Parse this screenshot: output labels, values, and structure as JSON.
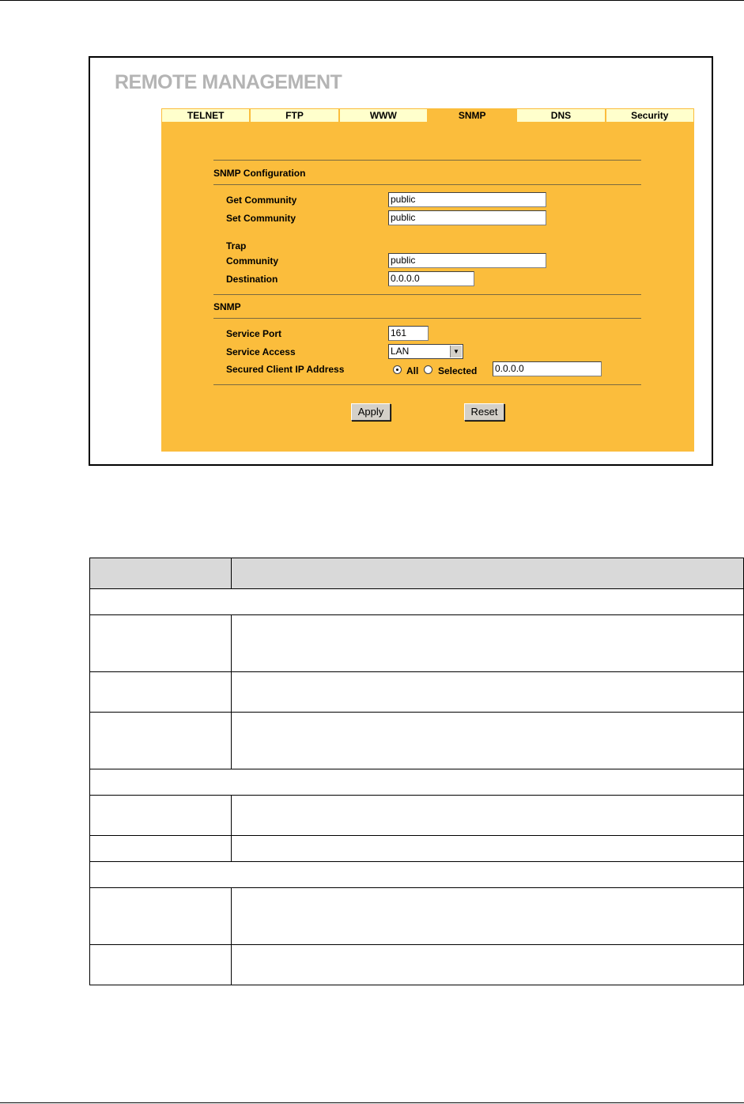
{
  "page_title": "REMOTE MANAGEMENT",
  "tabs": [
    {
      "label": "TELNET",
      "active": false
    },
    {
      "label": "FTP",
      "active": false
    },
    {
      "label": "WWW",
      "active": false
    },
    {
      "label": "SNMP",
      "active": true
    },
    {
      "label": "DNS",
      "active": false
    },
    {
      "label": "Security",
      "active": false
    }
  ],
  "snmp_config": {
    "section_label": "SNMP Configuration",
    "get_community_label": "Get Community",
    "get_community_value": "public",
    "set_community_label": "Set Community",
    "set_community_value": "public",
    "trap_label": "Trap",
    "trap_community_label": "Community",
    "trap_community_value": "public",
    "destination_label": "Destination",
    "destination_value": "0.0.0.0"
  },
  "snmp": {
    "section_label": "SNMP",
    "service_port_label": "Service Port",
    "service_port_value": "161",
    "service_access_label": "Service Access",
    "service_access_value": "LAN",
    "secured_client_label": "Secured Client IP Address",
    "radio_all_label": "All",
    "radio_selected_label": "Selected",
    "selected_option": "All",
    "secured_ip_value": "0.0.0.0"
  },
  "buttons": {
    "apply_label": "Apply",
    "reset_label": "Reset"
  },
  "colors": {
    "panel": "#fbbd3c",
    "tab_inactive": "#ffffcc",
    "title": "#b4b4b4"
  }
}
